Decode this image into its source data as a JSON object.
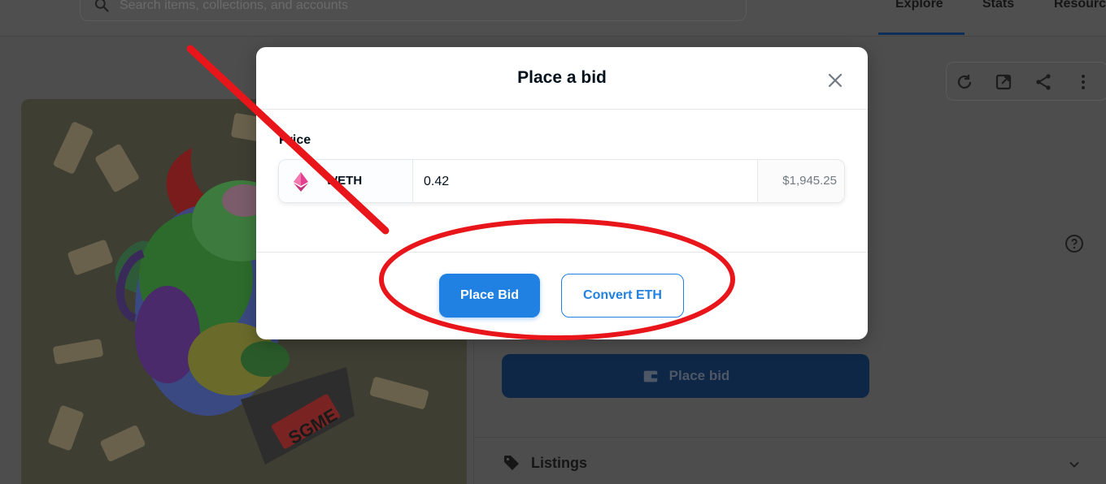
{
  "topbar": {
    "search_placeholder": "Search items, collections, and accounts",
    "nav": [
      "Explore",
      "Stats",
      "Resources"
    ]
  },
  "background": {
    "place_bid_label": "Place bid",
    "listings_label": "Listings",
    "artwork_text": "SGME"
  },
  "modal": {
    "title": "Place a bid",
    "price_label": "Price",
    "currency": "WETH",
    "amount": "0.42",
    "usd_value": "$1,945.25",
    "primary_button": "Place Bid",
    "secondary_button": "Convert ETH"
  },
  "colors": {
    "accent": "#2081e2",
    "annotation": "#e8161b",
    "eth_icon": "#e3418f"
  },
  "icons": [
    "search-icon",
    "refresh-icon",
    "open-external-icon",
    "share-icon",
    "more-icon",
    "help-icon",
    "wallet-icon",
    "tag-icon",
    "chevron-down-icon",
    "close-icon",
    "eth-icon"
  ]
}
